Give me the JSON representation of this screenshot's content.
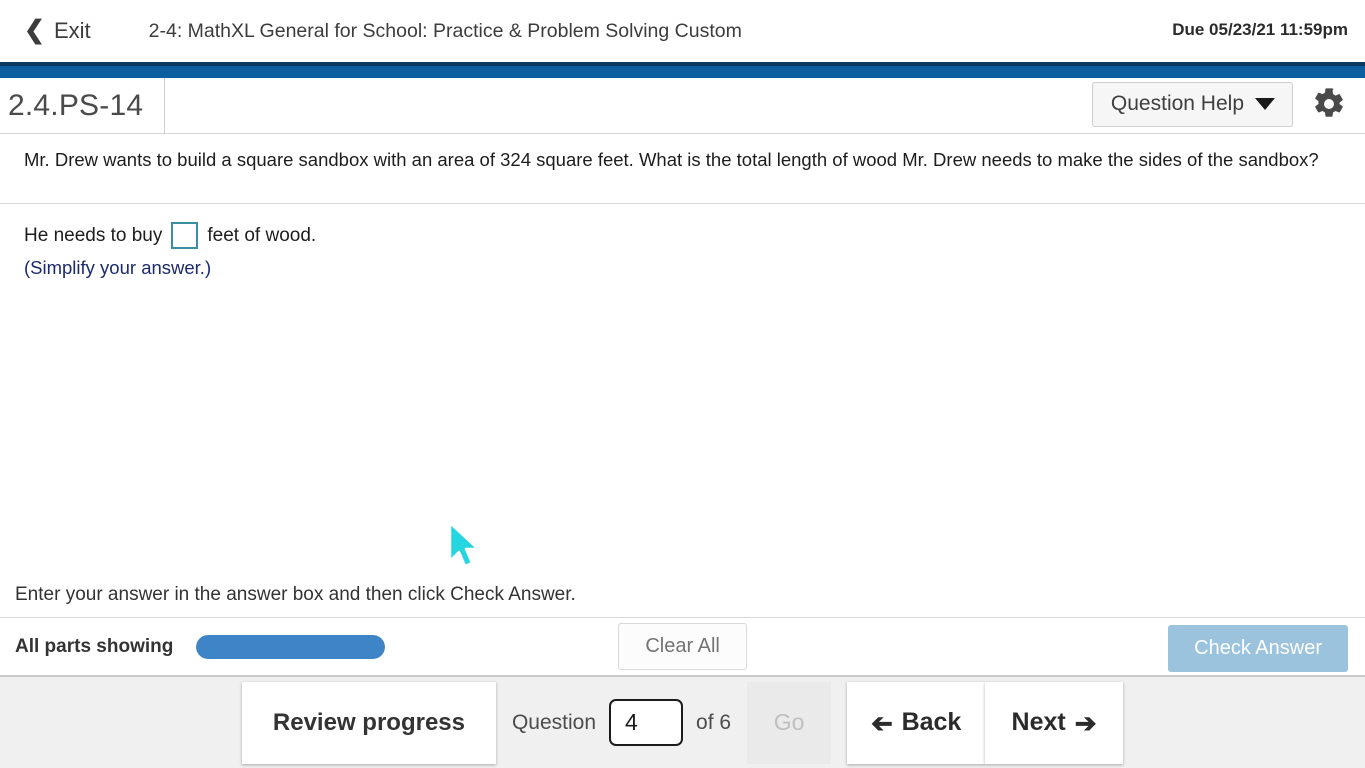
{
  "header": {
    "exit_label": "Exit",
    "exit_icon": "chevron-left-icon",
    "assignment_title": "2-4: MathXL General for School: Practice & Problem Solving Custom",
    "due_date": "Due 05/23/21 11:59pm"
  },
  "exercise": {
    "id": "2.4.PS-14",
    "question_help_label": "Question Help",
    "caret_icon": "caret-down-icon",
    "gear_icon": "gear-icon"
  },
  "question": {
    "prompt": "Mr. Drew wants to build a square sandbox with an area of 324 square feet. What is the total length of wood Mr. Drew needs to make the sides of the sandbox?",
    "answer_prefix": "He needs to buy",
    "answer_value": "",
    "answer_placeholder": "",
    "answer_suffix": "feet of wood.",
    "simplify_note": "(Simplify your answer.)"
  },
  "instruction": {
    "text": "Enter your answer in the answer box and then click Check Answer."
  },
  "action_bar": {
    "parts_label": "All parts showing",
    "progress_percent": 100,
    "clear_all_label": "Clear All",
    "check_answer_label": "Check Answer",
    "check_answer_disabled": true
  },
  "bottom_nav": {
    "review_label": "Review progress",
    "question_word": "Question",
    "question_number": "4",
    "of_count": "of 6",
    "go_label": "Go",
    "go_disabled": true,
    "back_label": "Back",
    "back_icon": "arrow-left-icon",
    "next_label": "Next",
    "next_icon": "arrow-right-icon"
  },
  "colors": {
    "brand_blue": "#0b5f9e",
    "brand_blue_dark": "#073a5e",
    "progress_blue": "#3d85c6",
    "answer_box_border": "#3a8fa0",
    "note_navy": "#1a2a6c",
    "check_answer_disabled_bg": "#9cc3de",
    "cursor_cyan": "#25d5e0"
  }
}
